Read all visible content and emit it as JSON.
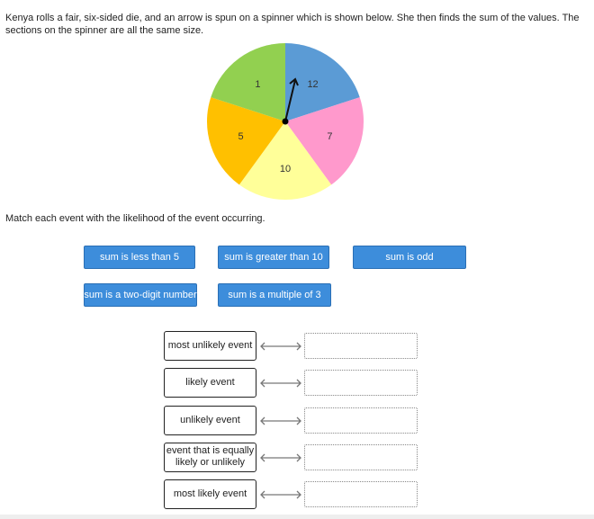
{
  "question": "Kenya rolls a fair, six-sided die, and an arrow is spun on a spinner which is shown below. She then finds the sum of the values. The sections on the spinner are all the same size.",
  "instruction": "Match each event with the likelihood of the event occurring.",
  "spinner": {
    "sections": [
      {
        "label": "12",
        "color": "#5b9bd5"
      },
      {
        "label": "7",
        "color": "#ff99cc"
      },
      {
        "label": "10",
        "color": "#ffff99"
      },
      {
        "label": "5",
        "color": "#ffc000"
      },
      {
        "label": "1",
        "color": "#92d050"
      }
    ],
    "arrow_points_to": "12"
  },
  "options": [
    "sum is less than 5",
    "sum is greater than 10",
    "sum is odd",
    "sum is a two-digit number",
    "sum is a multiple of 3"
  ],
  "likelihoods": [
    "most unlikely event",
    "likely event",
    "unlikely event",
    "event that is equally likely or unlikely",
    "most likely event"
  ],
  "colors": {
    "chip": "#3d8ddb"
  }
}
